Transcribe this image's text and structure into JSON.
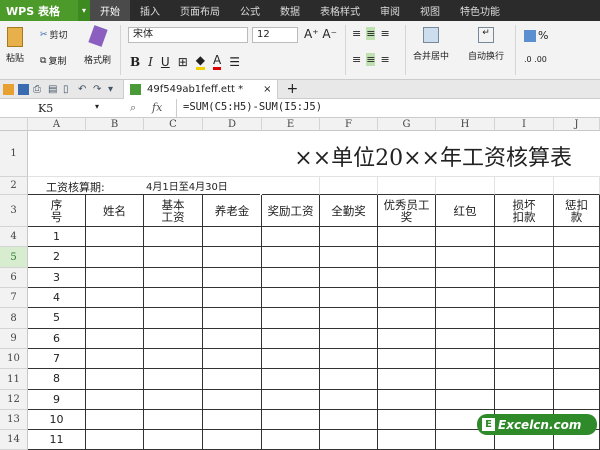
{
  "app": {
    "logo": "WPS 表格",
    "menu_tabs": [
      "开始",
      "插入",
      "页面布局",
      "公式",
      "数据",
      "表格样式",
      "审阅",
      "视图",
      "特色功能"
    ],
    "active_tab": 0
  },
  "ribbon": {
    "paste": "粘贴",
    "cut": "剪切",
    "copy": "复制",
    "format_painter": "格式刷",
    "font": "宋体",
    "size": "12",
    "bold": "B",
    "italic": "I",
    "underline": "U",
    "merge": "合并居中",
    "wrap": "自动换行",
    "percent": "%"
  },
  "doc": {
    "tab_name": "49f549ab1feff.ett *"
  },
  "formula": {
    "cell_ref": "K5",
    "fx": "fx",
    "value": "=SUM(C5:H5)-SUM(I5:J5)"
  },
  "columns": [
    "A",
    "B",
    "C",
    "D",
    "E",
    "F",
    "G",
    "H",
    "I",
    "J"
  ],
  "rows": [
    "1",
    "2",
    "3",
    "4",
    "5",
    "6",
    "7",
    "8",
    "9",
    "10",
    "11",
    "12",
    "13",
    "14"
  ],
  "sheet": {
    "title": "××单位20××年工资核算表",
    "period_label": "工资核算期:",
    "period_value": "4月1日至4月30日",
    "headers": [
      "序\n号",
      "姓名",
      "基本\n工资",
      "养老金",
      "奖励工资",
      "全勤奖",
      "优秀员工\n奖",
      "红包",
      "损坏\n扣款",
      "惩扣\n款"
    ],
    "serials": [
      "1",
      "2",
      "3",
      "4",
      "5",
      "6",
      "7",
      "8",
      "9",
      "10",
      "11"
    ]
  },
  "watermark": {
    "badge": "E",
    "text": "Excelcn.com"
  }
}
